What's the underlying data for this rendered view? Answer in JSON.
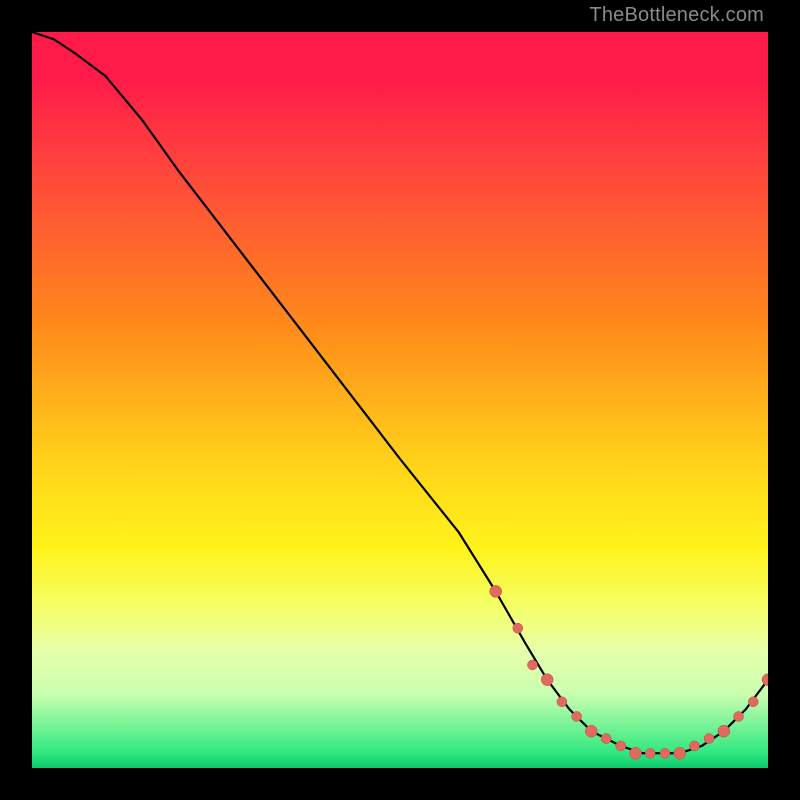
{
  "attribution": "TheBottleneck.com",
  "palette": {
    "curve_stroke": "#000000",
    "marker_fill": "#e06a60",
    "marker_stroke": "#c24a42"
  },
  "chart_data": {
    "type": "line",
    "title": "",
    "xlabel": "",
    "ylabel": "",
    "xlim": [
      0,
      100
    ],
    "ylim": [
      0,
      100
    ],
    "x": [
      0,
      3,
      6,
      10,
      15,
      20,
      30,
      40,
      50,
      58,
      63,
      67,
      70,
      73,
      76,
      80,
      83,
      86,
      88,
      91,
      94,
      97,
      100
    ],
    "values": [
      100,
      99,
      97,
      94,
      88,
      81,
      68,
      55,
      42,
      32,
      24,
      17,
      12,
      8,
      5,
      3,
      2,
      2,
      2,
      3,
      5,
      8,
      12
    ],
    "markers": {
      "x": [
        63,
        66,
        68,
        70,
        72,
        74,
        76,
        78,
        80,
        82,
        84,
        86,
        88,
        90,
        92,
        94,
        96,
        98,
        100
      ],
      "values": [
        24,
        19,
        14,
        12,
        9,
        7,
        5,
        4,
        3,
        2,
        2,
        2,
        2,
        3,
        4,
        5,
        7,
        9,
        12
      ]
    }
  }
}
